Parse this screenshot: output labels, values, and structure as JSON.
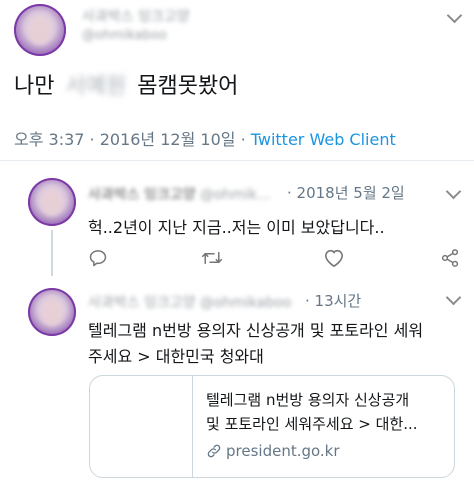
{
  "main_tweet": {
    "author_name": "사과박스 잉크고양",
    "author_handle": "@ohmikaboo",
    "text_before": "나만",
    "text_redacted": "서예원",
    "text_after": "몸캠못봤어",
    "meta_time": "오후 3:37 · 2016년 12월 10일 · ",
    "meta_client": "Twitter Web Client"
  },
  "reply1": {
    "author_name": "사과박스 잉크고양",
    "author_handle": "@ohmik...",
    "date": "· 2018년 5월 2일",
    "text": "헉..2년이 지난 지금..저는 이미 보았답니다.."
  },
  "reply2": {
    "author_name": "사과박스 잉크고양 @ohmikaboo",
    "date": "· 13시간",
    "text_line1": "텔레그램 n번방 용의자 신상공개 및 포토라인 세워",
    "text_line2": "주세요 > 대한민국 청와대",
    "card": {
      "title_line1": "텔레그램 n번방 용의자 신상공개",
      "title_line2": "및 포토라인 세워주세요 > 대한...",
      "domain": "president.go.kr"
    }
  },
  "icons": [
    "chevron-down-icon",
    "reply-icon",
    "retweet-icon",
    "like-icon",
    "share-icon",
    "link-icon"
  ],
  "colors": {
    "link": "#1b95e0",
    "muted": "#657786",
    "border": "#ccd6dd"
  }
}
